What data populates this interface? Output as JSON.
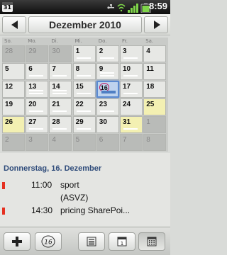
{
  "status_bar": {
    "calendar_day": "31",
    "time": "8:59",
    "icons": [
      "usb-icon",
      "wifi-icon",
      "signal-icon",
      "battery-icon"
    ]
  },
  "header": {
    "month_title": "Dezember 2010",
    "prev_icon": "arrow-left-icon",
    "next_icon": "arrow-right-icon"
  },
  "calendar": {
    "weekdays": [
      "So.",
      "Mo.",
      "Di.",
      "Mi.",
      "Do.",
      "Fr.",
      "Sa."
    ],
    "weeks": [
      [
        {
          "d": "28",
          "t": "other"
        },
        {
          "d": "29",
          "t": "other"
        },
        {
          "d": "30",
          "t": "other"
        },
        {
          "d": "1",
          "t": "cur",
          "ev": 1
        },
        {
          "d": "2",
          "t": "cur",
          "ev": 1
        },
        {
          "d": "3",
          "t": "cur",
          "ev": 1
        },
        {
          "d": "4",
          "t": "cur"
        }
      ],
      [
        {
          "d": "5",
          "t": "cur"
        },
        {
          "d": "6",
          "t": "cur",
          "ev": 1
        },
        {
          "d": "7",
          "t": "cur",
          "ev": 1
        },
        {
          "d": "8",
          "t": "cur",
          "ev": 1
        },
        {
          "d": "9",
          "t": "cur",
          "ev": 2
        },
        {
          "d": "10",
          "t": "cur",
          "ev": 1
        },
        {
          "d": "11",
          "t": "cur"
        }
      ],
      [
        {
          "d": "12",
          "t": "cur"
        },
        {
          "d": "13",
          "t": "cur",
          "ev": 2
        },
        {
          "d": "14",
          "t": "cur",
          "ev": 2
        },
        {
          "d": "15",
          "t": "cur",
          "ev": 1
        },
        {
          "d": "16",
          "t": "today",
          "ev": 1
        },
        {
          "d": "17",
          "t": "cur",
          "ev": 1
        },
        {
          "d": "18",
          "t": "cur"
        }
      ],
      [
        {
          "d": "19",
          "t": "cur"
        },
        {
          "d": "20",
          "t": "cur",
          "ev": 1
        },
        {
          "d": "21",
          "t": "cur",
          "ev": 1
        },
        {
          "d": "22",
          "t": "cur",
          "ev": 1
        },
        {
          "d": "23",
          "t": "cur",
          "ev": 1
        },
        {
          "d": "24",
          "t": "cur"
        },
        {
          "d": "25",
          "t": "weekend"
        }
      ],
      [
        {
          "d": "26",
          "t": "weekend"
        },
        {
          "d": "27",
          "t": "cur",
          "ev": 1
        },
        {
          "d": "28",
          "t": "cur",
          "ev": 1
        },
        {
          "d": "29",
          "t": "cur",
          "ev": 1
        },
        {
          "d": "30",
          "t": "cur"
        },
        {
          "d": "31",
          "t": "weekend",
          "ev": 1
        },
        {
          "d": "1",
          "t": "other"
        }
      ],
      [
        {
          "d": "2",
          "t": "other"
        },
        {
          "d": "3",
          "t": "other"
        },
        {
          "d": "4",
          "t": "other"
        },
        {
          "d": "5",
          "t": "other"
        },
        {
          "d": "6",
          "t": "other"
        },
        {
          "d": "7",
          "t": "other"
        },
        {
          "d": "8",
          "t": "other"
        }
      ]
    ]
  },
  "agenda": {
    "date_label": "Donnerstag, 16. Dezember",
    "events": [
      {
        "time": "11:00",
        "title": "sport",
        "marker": true
      },
      {
        "time": "",
        "title": "(ASVZ)",
        "marker": false
      },
      {
        "time": "14:30",
        "title": "pricing SharePoi...",
        "marker": true
      }
    ]
  },
  "toolbar": {
    "buttons": [
      {
        "name": "add-event-button",
        "icon": "plus-icon"
      },
      {
        "name": "today-button",
        "icon": "today-calendar-icon",
        "label": "16"
      },
      {
        "name": "agenda-view-button",
        "icon": "list-icon"
      },
      {
        "name": "day-view-button",
        "icon": "day-icon",
        "label": "1"
      },
      {
        "name": "month-view-button",
        "icon": "grid-icon"
      }
    ]
  }
}
